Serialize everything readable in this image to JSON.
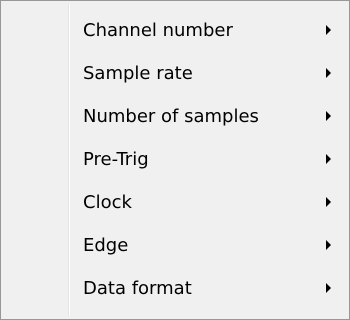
{
  "menu": {
    "items": [
      {
        "label": "Channel number",
        "icon": "chevron-right-icon"
      },
      {
        "label": "Sample rate",
        "icon": "chevron-right-icon"
      },
      {
        "label": "Number of samples",
        "icon": "chevron-right-icon"
      },
      {
        "label": "Pre-Trig",
        "icon": "chevron-right-icon"
      },
      {
        "label": "Clock",
        "icon": "chevron-right-icon"
      },
      {
        "label": "Edge",
        "icon": "chevron-right-icon"
      },
      {
        "label": "Data format",
        "icon": "chevron-right-icon"
      }
    ]
  },
  "colors": {
    "background": "#f0f0f0",
    "border": "#979797",
    "separator": "#e2e3e3",
    "text": "#000000"
  }
}
